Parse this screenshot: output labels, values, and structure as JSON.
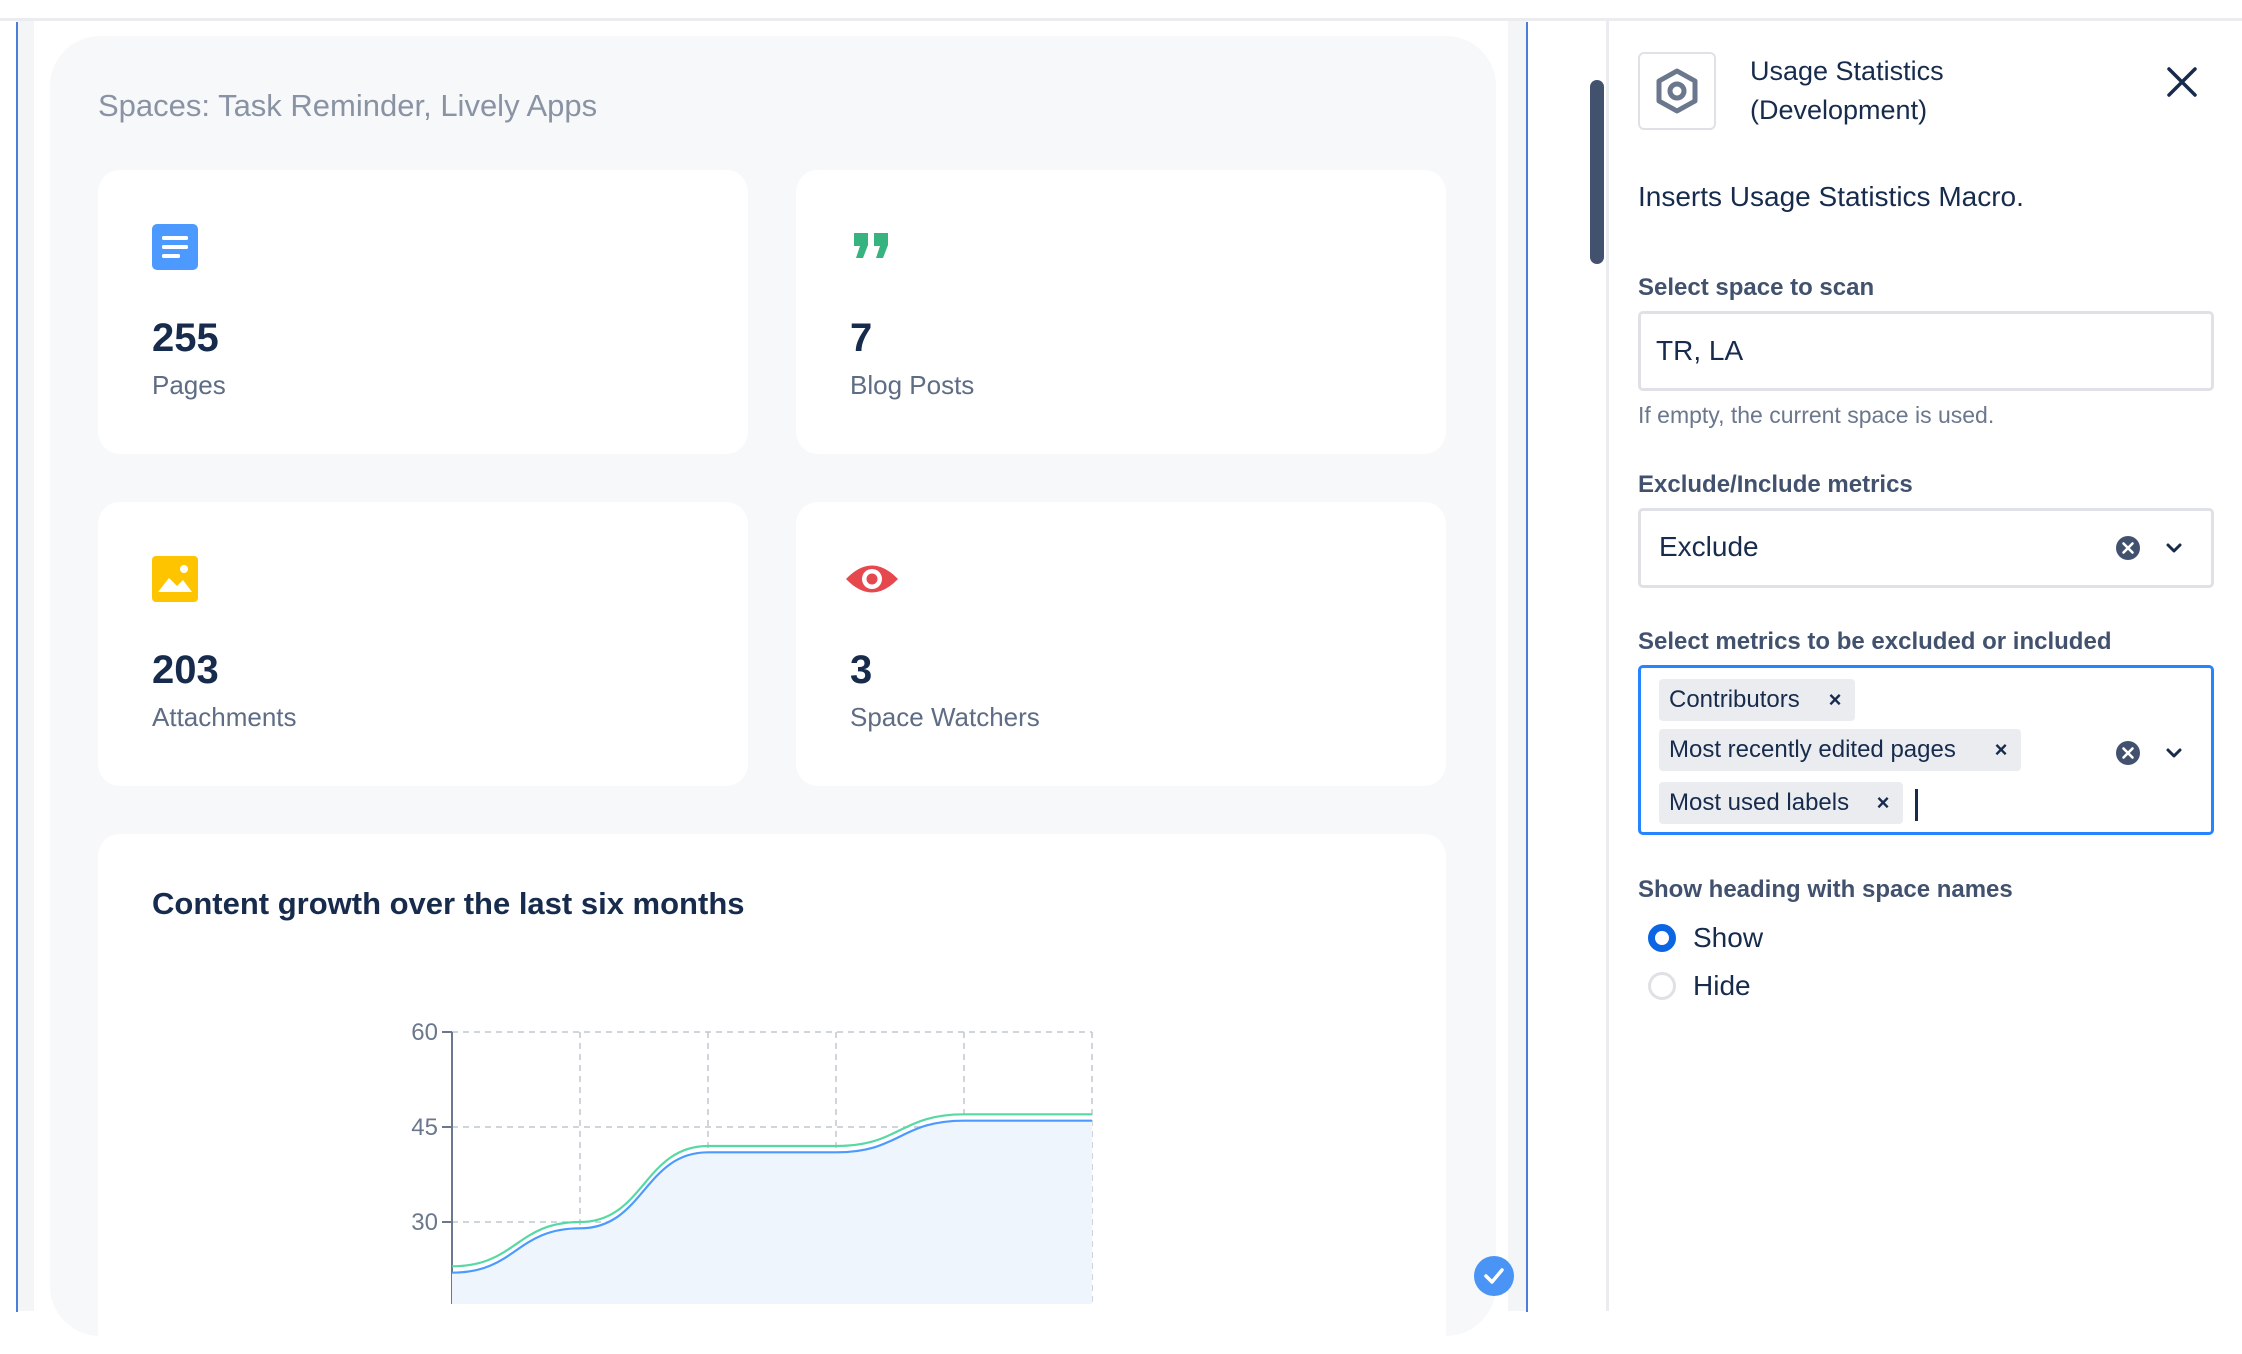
{
  "canvas": {
    "spaces_heading": "Spaces: Task Reminder, Lively Apps",
    "cards": [
      {
        "icon": "pages-icon",
        "value": "255",
        "label": "Pages",
        "color": "#4c9aff"
      },
      {
        "icon": "quote-icon",
        "value": "7",
        "label": "Blog Posts",
        "color": "#36b37e"
      },
      {
        "icon": "image-icon",
        "value": "203",
        "label": "Attachments",
        "color": "#ffc400"
      },
      {
        "icon": "eye-icon",
        "value": "3",
        "label": "Space Watchers",
        "color": "#de350b"
      }
    ],
    "chart_title": "Content growth over the last six months"
  },
  "chart_data": {
    "type": "line",
    "title": "Content growth over the last six months",
    "y_ticks": [
      "60",
      "45",
      "30"
    ],
    "ylim": [
      30,
      60
    ],
    "grid": true,
    "series": [
      {
        "color": "#57d9a3",
        "values": [
          23,
          30,
          42,
          42,
          47,
          47
        ]
      },
      {
        "color": "#4c9aff",
        "values": [
          22,
          29,
          41,
          41,
          46,
          46
        ]
      }
    ]
  },
  "panel": {
    "macro_title": "Usage Statistics (Development)",
    "macro_description": "Inserts Usage Statistics Macro.",
    "space_field": {
      "label": "Select space to scan",
      "value": "TR, LA",
      "help": "If empty, the current space is used."
    },
    "mode_field": {
      "label": "Exclude/Include metrics",
      "value": "Exclude"
    },
    "metrics_field": {
      "label": "Select metrics to be excluded or included",
      "tags": [
        "Contributors",
        "Most recently edited pages",
        "Most used labels"
      ],
      "tag_remove": "×"
    },
    "heading_field": {
      "label": "Show heading with space names",
      "options": [
        "Show",
        "Hide"
      ],
      "selected": "Show"
    }
  }
}
